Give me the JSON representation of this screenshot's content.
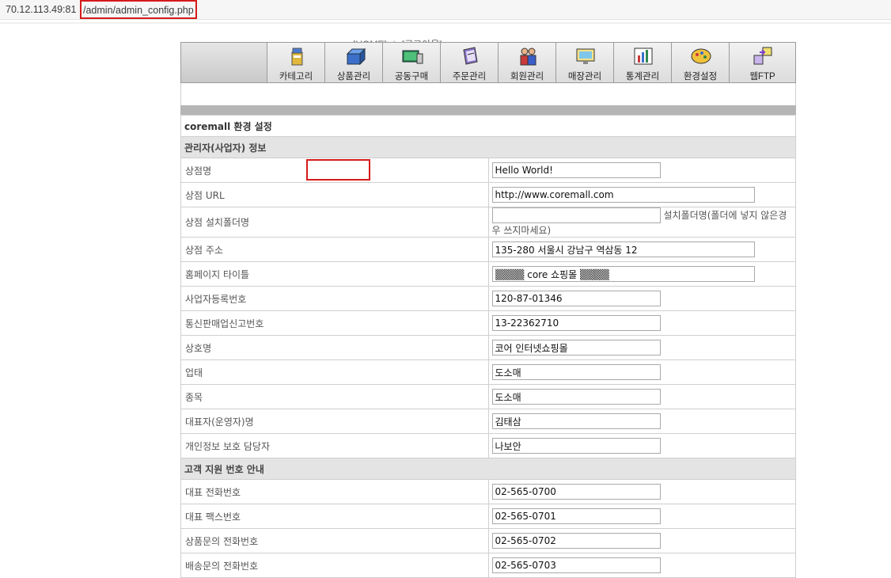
{
  "address": {
    "host": "70.12.113.49:81",
    "path": "/admin/admin_config.php"
  },
  "top_links": {
    "home": "[HOME]",
    "sep": "|",
    "logout": "[로그아웃]"
  },
  "nav": [
    {
      "label": "카테고리",
      "icon": "category-icon"
    },
    {
      "label": "상품관리",
      "icon": "product-icon"
    },
    {
      "label": "공동구매",
      "icon": "group-buy-icon"
    },
    {
      "label": "주문관리",
      "icon": "order-icon"
    },
    {
      "label": "회원관리",
      "icon": "member-icon"
    },
    {
      "label": "매장관리",
      "icon": "store-icon"
    },
    {
      "label": "통계관리",
      "icon": "stats-icon"
    },
    {
      "label": "환경설정",
      "icon": "settings-icon"
    },
    {
      "label": "웹FTP",
      "icon": "webftp-icon"
    }
  ],
  "form": {
    "title": "coremall 환경 설정",
    "section_admin": "관리자(사업자) 정보",
    "section_support": "고객 지원 번호 안내",
    "fields": {
      "shop_name": {
        "label": "상점명",
        "value": "Hello World!"
      },
      "shop_url": {
        "label": "상점 URL",
        "value": "http://www.coremall.com"
      },
      "install_folder": {
        "label": "상점 설치폴더명",
        "value": "",
        "hint": "설치폴더명(폴더에 넣지 않은경우 쓰지마세요)"
      },
      "shop_address": {
        "label": "상점 주소",
        "value": "135-280 서울시 강남구 역삼동 12"
      },
      "homepage_title": {
        "label": "홈페이지 타이틀",
        "value": "▒▒▒▒ core 쇼핑몰 ▒▒▒▒"
      },
      "business_no": {
        "label": "사업자등록번호",
        "value": "120-87-01346"
      },
      "mail_order_no": {
        "label": "통신판매업신고번호",
        "value": "13-22362710"
      },
      "company_name": {
        "label": "상호명",
        "value": "코어 인터넷쇼핑몰"
      },
      "business_type": {
        "label": "업태",
        "value": "도소매"
      },
      "business_item": {
        "label": "종목",
        "value": "도소매"
      },
      "ceo_name": {
        "label": "대표자(운영자)명",
        "value": "김태삼"
      },
      "privacy_officer": {
        "label": "개인정보 보호 담당자",
        "value": "나보안"
      },
      "main_phone": {
        "label": "대표 전화번호",
        "value": "02-565-0700"
      },
      "main_fax": {
        "label": "대표 팩스번호",
        "value": "02-565-0701"
      },
      "product_phone": {
        "label": "상품문의 전화번호",
        "value": "02-565-0702"
      },
      "delivery_phone": {
        "label": "배송문의 전화번호",
        "value": "02-565-0703"
      }
    }
  },
  "colors": {
    "highlight": "#d61a1a",
    "section_bg": "#e4e4e4",
    "bar_grey": "#b5b5b5"
  }
}
